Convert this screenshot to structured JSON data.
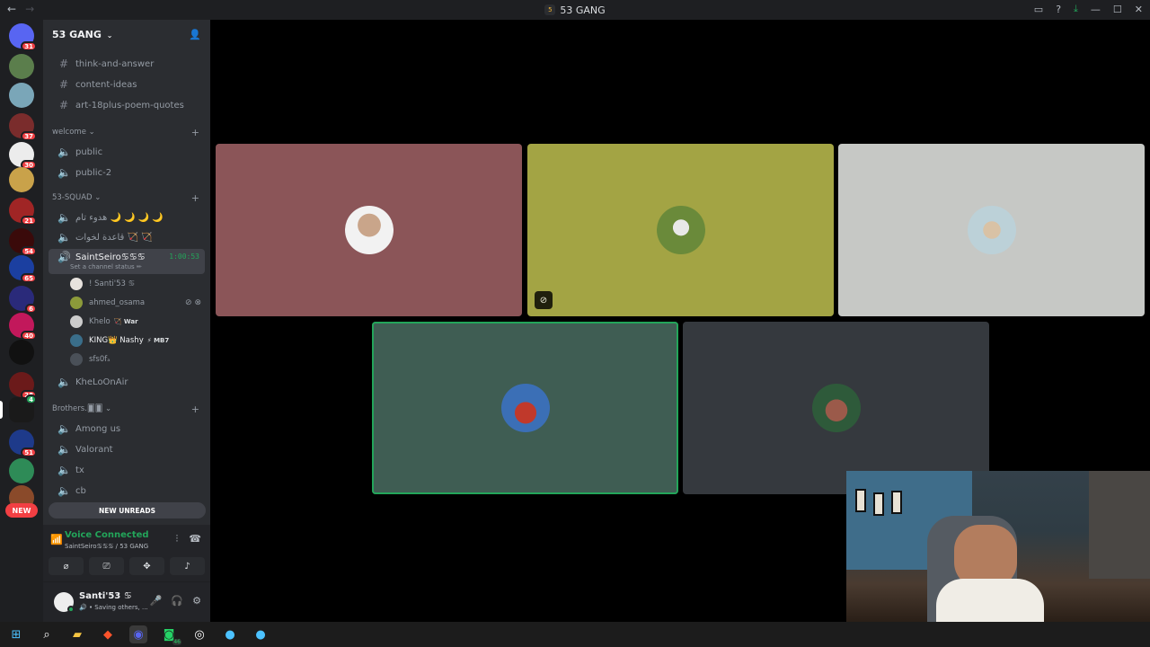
{
  "window": {
    "title": "53 GANG"
  },
  "colors": {
    "accent_green": "#23a55a",
    "sidebar_bg": "#2b2d31",
    "rail_bg": "#1e1f22",
    "badge_red": "#f23f43"
  },
  "guild_badges": [
    "31",
    "",
    "",
    "37",
    "30",
    "",
    "21",
    "54",
    "65",
    "6",
    "40",
    "",
    "28",
    "4",
    "51",
    "",
    ""
  ],
  "new_pill": "NEW",
  "server": {
    "name": "53 GANG"
  },
  "channels_top": [
    {
      "name": "think-and-answer",
      "icon": "hash-icon"
    },
    {
      "name": "content-ideas",
      "icon": "hash-icon"
    },
    {
      "name": "art-18plus-poem-quotes",
      "icon": "hash-icon"
    }
  ],
  "category_welcome": {
    "name": "welcome",
    "channels": [
      "public",
      "public-2"
    ]
  },
  "category_squad": {
    "name": "53-SQUAD",
    "channels": [
      "هدوء تام 🌙 🌙 🌙 🌙",
      "قاعدة لخوات 🏹 🏹"
    ]
  },
  "active_voice": {
    "name": "SaintSeiro♋♋♋",
    "timer": "1:00:53",
    "status": "Set a channel status ✏",
    "users": [
      {
        "name": "! Santi'53 ♋",
        "tag": ""
      },
      {
        "name": "ahmed_osama",
        "tag": ""
      },
      {
        "name": "Khelo",
        "tag": "🏹 War"
      },
      {
        "name": "KING👑 Nashy",
        "tag": "⚡ MB7"
      },
      {
        "name": "sfs0fₐ",
        "tag": ""
      }
    ]
  },
  "khelo_channel": "KheLoOnAir",
  "category_brothers": {
    "name": "Brothers.🂠🂠",
    "channels": [
      "Among us",
      "Valorant",
      "tx",
      "cb"
    ]
  },
  "new_unreads": "NEW UNREADS",
  "voice_panel": {
    "title": "Voice Connected",
    "subtitle": "SaintSeiro♋♋♋ / 53 GANG"
  },
  "user_panel": {
    "name": "Santi'53 ♋",
    "status": "🔊 • Saving others, ..."
  }
}
